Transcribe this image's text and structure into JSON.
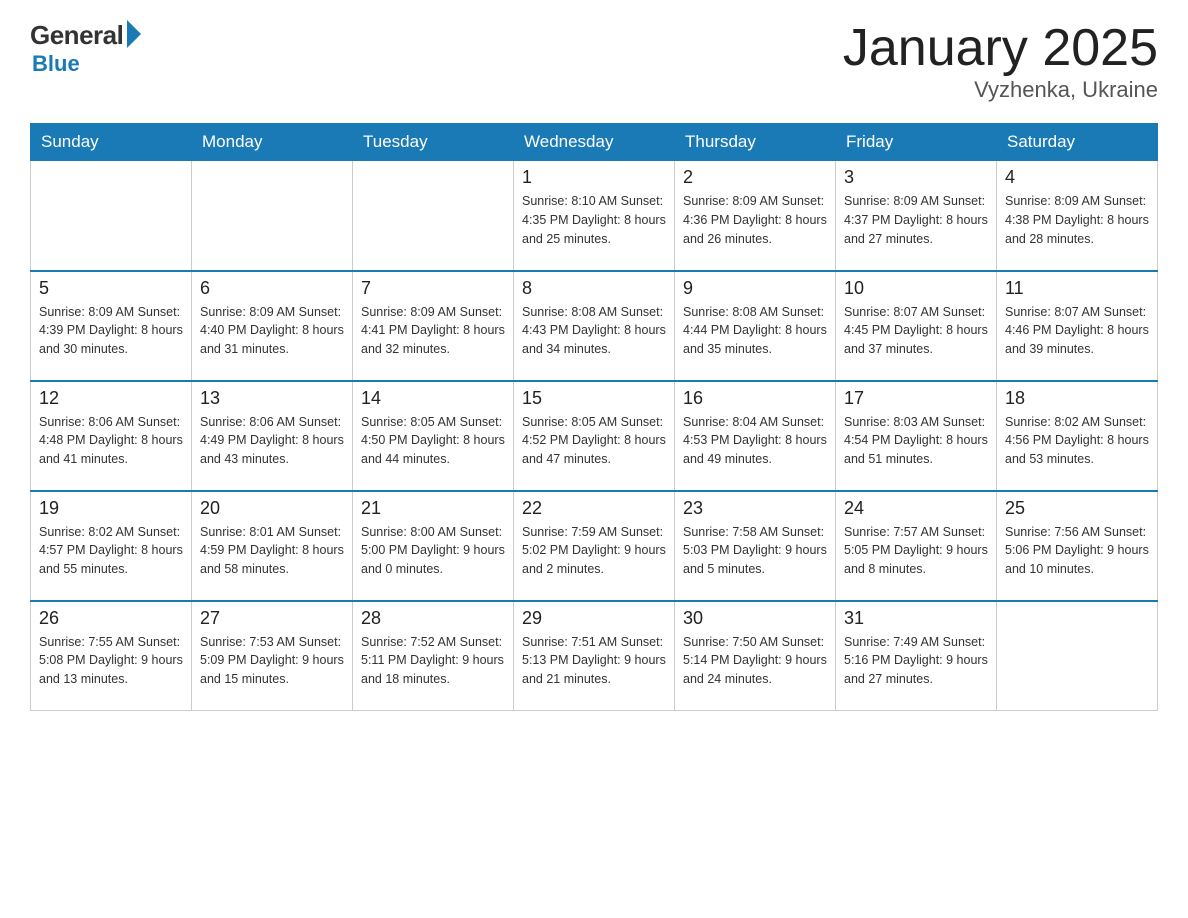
{
  "header": {
    "logo": {
      "general": "General",
      "blue": "Blue"
    },
    "title": "January 2025",
    "location": "Vyzhenka, Ukraine"
  },
  "weekdays": [
    "Sunday",
    "Monday",
    "Tuesday",
    "Wednesday",
    "Thursday",
    "Friday",
    "Saturday"
  ],
  "weeks": [
    [
      {
        "day": "",
        "info": ""
      },
      {
        "day": "",
        "info": ""
      },
      {
        "day": "",
        "info": ""
      },
      {
        "day": "1",
        "info": "Sunrise: 8:10 AM\nSunset: 4:35 PM\nDaylight: 8 hours\nand 25 minutes."
      },
      {
        "day": "2",
        "info": "Sunrise: 8:09 AM\nSunset: 4:36 PM\nDaylight: 8 hours\nand 26 minutes."
      },
      {
        "day": "3",
        "info": "Sunrise: 8:09 AM\nSunset: 4:37 PM\nDaylight: 8 hours\nand 27 minutes."
      },
      {
        "day": "4",
        "info": "Sunrise: 8:09 AM\nSunset: 4:38 PM\nDaylight: 8 hours\nand 28 minutes."
      }
    ],
    [
      {
        "day": "5",
        "info": "Sunrise: 8:09 AM\nSunset: 4:39 PM\nDaylight: 8 hours\nand 30 minutes."
      },
      {
        "day": "6",
        "info": "Sunrise: 8:09 AM\nSunset: 4:40 PM\nDaylight: 8 hours\nand 31 minutes."
      },
      {
        "day": "7",
        "info": "Sunrise: 8:09 AM\nSunset: 4:41 PM\nDaylight: 8 hours\nand 32 minutes."
      },
      {
        "day": "8",
        "info": "Sunrise: 8:08 AM\nSunset: 4:43 PM\nDaylight: 8 hours\nand 34 minutes."
      },
      {
        "day": "9",
        "info": "Sunrise: 8:08 AM\nSunset: 4:44 PM\nDaylight: 8 hours\nand 35 minutes."
      },
      {
        "day": "10",
        "info": "Sunrise: 8:07 AM\nSunset: 4:45 PM\nDaylight: 8 hours\nand 37 minutes."
      },
      {
        "day": "11",
        "info": "Sunrise: 8:07 AM\nSunset: 4:46 PM\nDaylight: 8 hours\nand 39 minutes."
      }
    ],
    [
      {
        "day": "12",
        "info": "Sunrise: 8:06 AM\nSunset: 4:48 PM\nDaylight: 8 hours\nand 41 minutes."
      },
      {
        "day": "13",
        "info": "Sunrise: 8:06 AM\nSunset: 4:49 PM\nDaylight: 8 hours\nand 43 minutes."
      },
      {
        "day": "14",
        "info": "Sunrise: 8:05 AM\nSunset: 4:50 PM\nDaylight: 8 hours\nand 44 minutes."
      },
      {
        "day": "15",
        "info": "Sunrise: 8:05 AM\nSunset: 4:52 PM\nDaylight: 8 hours\nand 47 minutes."
      },
      {
        "day": "16",
        "info": "Sunrise: 8:04 AM\nSunset: 4:53 PM\nDaylight: 8 hours\nand 49 minutes."
      },
      {
        "day": "17",
        "info": "Sunrise: 8:03 AM\nSunset: 4:54 PM\nDaylight: 8 hours\nand 51 minutes."
      },
      {
        "day": "18",
        "info": "Sunrise: 8:02 AM\nSunset: 4:56 PM\nDaylight: 8 hours\nand 53 minutes."
      }
    ],
    [
      {
        "day": "19",
        "info": "Sunrise: 8:02 AM\nSunset: 4:57 PM\nDaylight: 8 hours\nand 55 minutes."
      },
      {
        "day": "20",
        "info": "Sunrise: 8:01 AM\nSunset: 4:59 PM\nDaylight: 8 hours\nand 58 minutes."
      },
      {
        "day": "21",
        "info": "Sunrise: 8:00 AM\nSunset: 5:00 PM\nDaylight: 9 hours\nand 0 minutes."
      },
      {
        "day": "22",
        "info": "Sunrise: 7:59 AM\nSunset: 5:02 PM\nDaylight: 9 hours\nand 2 minutes."
      },
      {
        "day": "23",
        "info": "Sunrise: 7:58 AM\nSunset: 5:03 PM\nDaylight: 9 hours\nand 5 minutes."
      },
      {
        "day": "24",
        "info": "Sunrise: 7:57 AM\nSunset: 5:05 PM\nDaylight: 9 hours\nand 8 minutes."
      },
      {
        "day": "25",
        "info": "Sunrise: 7:56 AM\nSunset: 5:06 PM\nDaylight: 9 hours\nand 10 minutes."
      }
    ],
    [
      {
        "day": "26",
        "info": "Sunrise: 7:55 AM\nSunset: 5:08 PM\nDaylight: 9 hours\nand 13 minutes."
      },
      {
        "day": "27",
        "info": "Sunrise: 7:53 AM\nSunset: 5:09 PM\nDaylight: 9 hours\nand 15 minutes."
      },
      {
        "day": "28",
        "info": "Sunrise: 7:52 AM\nSunset: 5:11 PM\nDaylight: 9 hours\nand 18 minutes."
      },
      {
        "day": "29",
        "info": "Sunrise: 7:51 AM\nSunset: 5:13 PM\nDaylight: 9 hours\nand 21 minutes."
      },
      {
        "day": "30",
        "info": "Sunrise: 7:50 AM\nSunset: 5:14 PM\nDaylight: 9 hours\nand 24 minutes."
      },
      {
        "day": "31",
        "info": "Sunrise: 7:49 AM\nSunset: 5:16 PM\nDaylight: 9 hours\nand 27 minutes."
      },
      {
        "day": "",
        "info": ""
      }
    ]
  ]
}
